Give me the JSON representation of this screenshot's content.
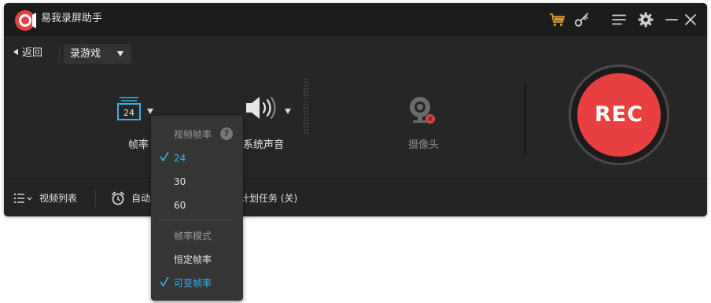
{
  "app": {
    "title": "易我录屏助手"
  },
  "titlebar": {
    "icons": [
      "cart-icon",
      "key-icon",
      "menu-icon",
      "settings-icon",
      "minimize-icon",
      "close-icon"
    ]
  },
  "nav": {
    "back_label": "返回",
    "mode_value": "录游戏"
  },
  "controls": {
    "frame_rate": {
      "label": "帧率",
      "value": "24",
      "icon": "frame-rate-icon"
    },
    "system_audio": {
      "label": "系统声音",
      "icon": "speaker-icon"
    },
    "camera": {
      "label": "摄像头",
      "icon": "webcam-icon",
      "status": "disabled"
    }
  },
  "rec_button": {
    "label": "REC",
    "color": "#e84040"
  },
  "bottom": {
    "video_list_label": "视频列表",
    "auto_label": "自动",
    "schedule_label": "计划任务 (关)"
  },
  "menu": {
    "video_frame_rate_header": "视频帧率",
    "help_icon": "?",
    "rates": [
      {
        "label": "24",
        "selected": true
      },
      {
        "label": "30",
        "selected": false
      },
      {
        "label": "60",
        "selected": false
      }
    ],
    "frame_mode_header": "帧率模式",
    "modes": [
      {
        "label": "恒定帧率",
        "selected": false
      },
      {
        "label": "可变帧率",
        "selected": true
      }
    ]
  },
  "colors": {
    "accent": "#35b4e8",
    "rec": "#e84040",
    "window_bg": "#262626",
    "titlebar_bg": "#1c1c1c"
  }
}
